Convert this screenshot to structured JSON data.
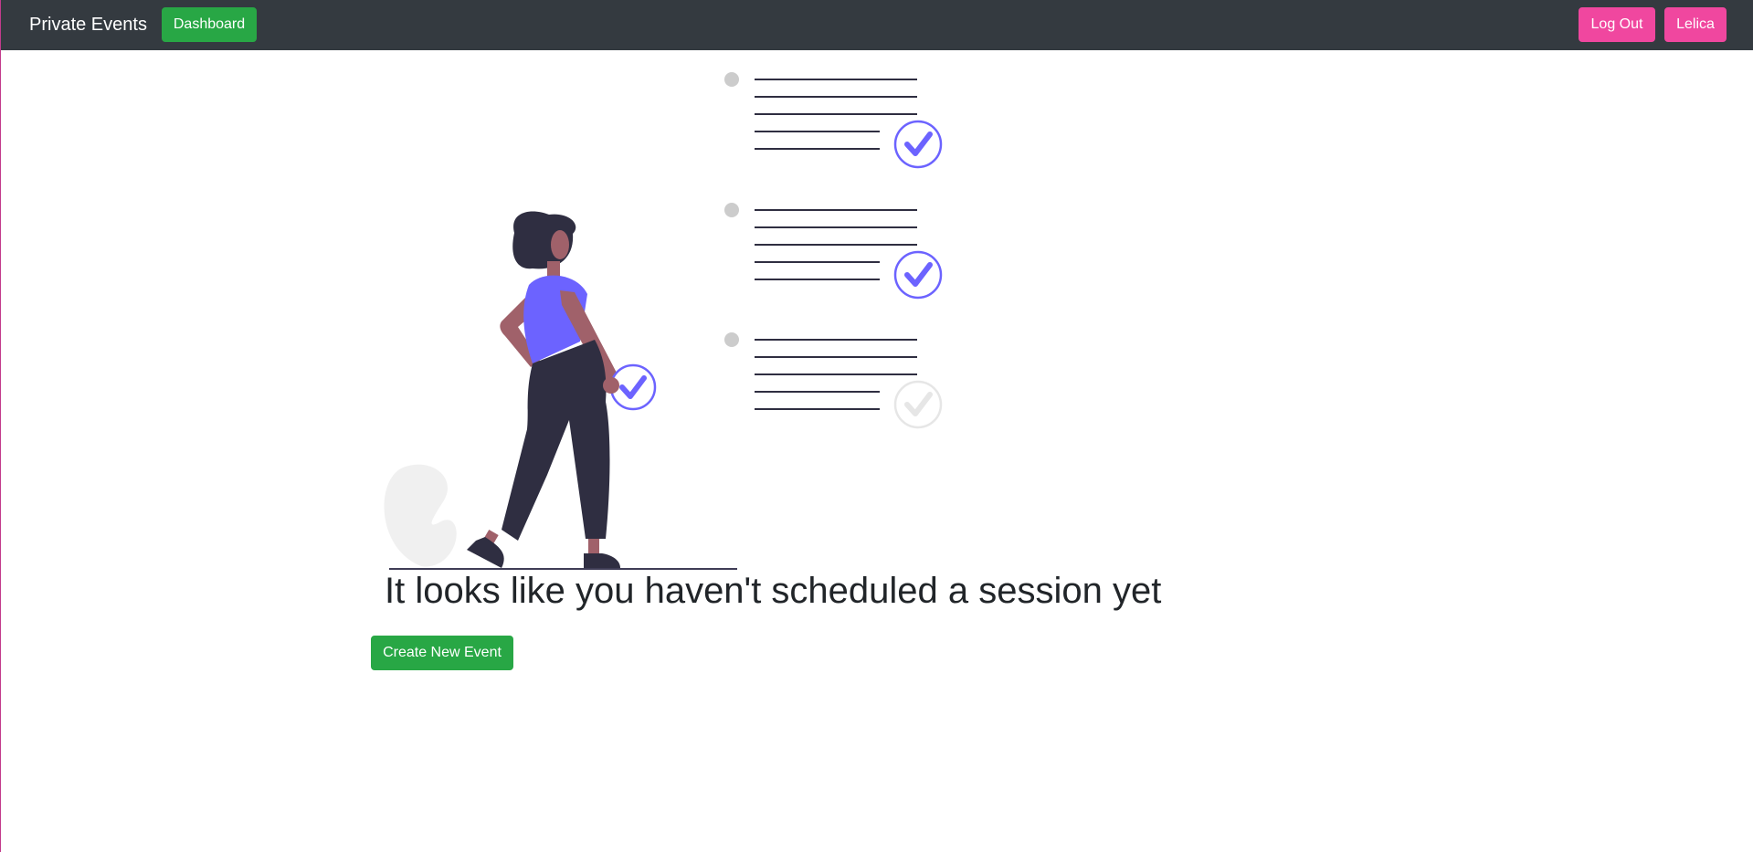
{
  "navbar": {
    "brand": "Private Events",
    "dashboard_label": "Dashboard",
    "logout_label": "Log Out",
    "user_label": "Lelica"
  },
  "main": {
    "empty_message": "It looks like you haven't scheduled a session yet",
    "create_label": "Create New Event"
  },
  "illustration": {
    "icons": [
      "woman-figure",
      "checklist",
      "check-circle-icon",
      "plant-leaf"
    ],
    "checklist_items_checked": [
      true,
      true,
      false
    ]
  },
  "colors": {
    "navbar_bg": "#343a40",
    "green_button": "#28a745",
    "pink_button": "#f0479f",
    "accent_purple": "#6c63ff",
    "headline_text": "#212529"
  }
}
